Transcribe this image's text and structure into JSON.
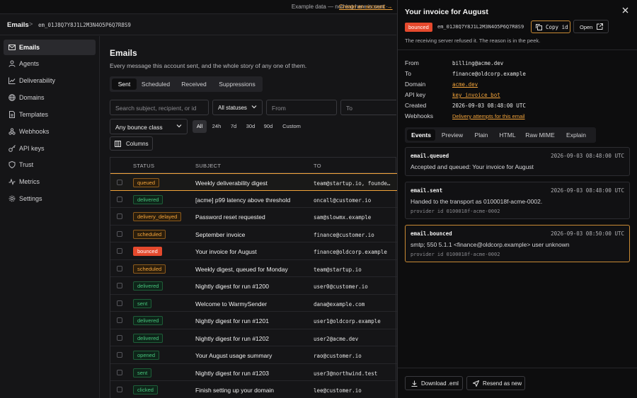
{
  "banner": {
    "text": "Example data — nothing here is sent ·",
    "link": "Create an account →"
  },
  "breadcrumb": {
    "root": "Emails",
    "sep": ">",
    "id": "em_01J8Q7Y8J1L2M3N4O5P6Q7R8S9"
  },
  "sidebar": {
    "items": [
      {
        "label": "Emails",
        "icon": "mail-icon",
        "active": true
      },
      {
        "label": "Agents",
        "icon": "agents-icon"
      },
      {
        "label": "Deliverability",
        "icon": "chart-icon"
      },
      {
        "label": "Domains",
        "icon": "globe-icon"
      },
      {
        "label": "Templates",
        "icon": "file-icon"
      },
      {
        "label": "Webhooks",
        "icon": "webhook-icon"
      },
      {
        "label": "API keys",
        "icon": "key-icon"
      },
      {
        "label": "Trust",
        "icon": "shield-icon"
      },
      {
        "label": "Metrics",
        "icon": "metrics-icon"
      },
      {
        "label": "Settings",
        "icon": "gear-icon"
      }
    ]
  },
  "main": {
    "title": "Emails",
    "subtitle": "Every message this account sent, and the whole story of any one of them.",
    "tabs": [
      "Sent",
      "Scheduled",
      "Received",
      "Suppressions"
    ],
    "search_placeholder": "Search subject, recipient, or id",
    "status_select": "All statuses",
    "from_placeholder": "From",
    "to_placeholder": "To",
    "bounce_select": "Any bounce class",
    "ranges": [
      "All",
      "24h",
      "7d",
      "30d",
      "90d",
      "Custom"
    ],
    "columns_button": "Columns"
  },
  "table": {
    "headers": [
      "STATUS",
      "SUBJECT",
      "TO"
    ],
    "rows": [
      {
        "status": "queued",
        "kind": "queued",
        "subject": "Weekly deliverability digest",
        "to": "team@startup.io, founde…"
      },
      {
        "status": "delivered",
        "kind": "delivered",
        "subject": "[acme] p99 latency above threshold",
        "to": "oncall@customer.io"
      },
      {
        "status": "delivery_delayed",
        "kind": "delayed",
        "subject": "Password reset requested",
        "to": "sam@slowmx.example"
      },
      {
        "status": "scheduled",
        "kind": "scheduled",
        "subject": "September invoice",
        "to": "finance@customer.io"
      },
      {
        "status": "bounced",
        "kind": "bounced",
        "subject": "Your invoice for August",
        "to": "finance@oldcorp.example"
      },
      {
        "status": "scheduled",
        "kind": "scheduled",
        "subject": "Weekly digest, queued for Monday",
        "to": "team@startup.io"
      },
      {
        "status": "delivered",
        "kind": "delivered",
        "subject": "Nightly digest for run #1200",
        "to": "user0@customer.io"
      },
      {
        "status": "sent",
        "kind": "sent",
        "subject": "Welcome to WarmySender",
        "to": "dana@example.com"
      },
      {
        "status": "delivered",
        "kind": "delivered",
        "subject": "Nightly digest for run #1201",
        "to": "user1@oldcorp.example"
      },
      {
        "status": "delivered",
        "kind": "delivered",
        "subject": "Nightly digest for run #1202",
        "to": "user2@acme.dev"
      },
      {
        "status": "opened",
        "kind": "opened",
        "subject": "Your August usage summary",
        "to": "rao@customer.io"
      },
      {
        "status": "sent",
        "kind": "sent",
        "subject": "Nightly digest for run #1203",
        "to": "user3@northwind.test"
      },
      {
        "status": "clicked",
        "kind": "clicked",
        "subject": "Finish setting up your domain",
        "to": "lee@customer.io"
      }
    ]
  },
  "panel": {
    "title": "Your invoice for August",
    "badge": "bounced",
    "id": "em_01J8Q7Y8J1L2M3N4O5P6Q7R8S9",
    "copy_label": "Copy id",
    "open_label": "Open",
    "reason": "The receiving server refused it. The reason is in the peek.",
    "meta": [
      {
        "label": "From",
        "value": "billing@acme.dev",
        "link": false
      },
      {
        "label": "To",
        "value": "finance@oldcorp.example",
        "link": false
      },
      {
        "label": "Domain",
        "value": "acme.dev",
        "link": true
      },
      {
        "label": "API key",
        "value": "key_invoice_bot",
        "link": true
      },
      {
        "label": "Created",
        "value": "2026-09-03 08:48:00 UTC",
        "link": false
      },
      {
        "label": "Webhooks",
        "value": "Delivery attempts for this email",
        "link": true
      }
    ],
    "tabs": [
      "Events",
      "Preview",
      "Plain",
      "HTML",
      "Raw MIME",
      "Explain"
    ],
    "events": [
      {
        "name": "email.queued",
        "time": "2026-09-03 08:48:00 UTC",
        "message": "Accepted and queued: Your invoice for August",
        "provider": ""
      },
      {
        "name": "email.sent",
        "time": "2026-09-03 08:48:00 UTC",
        "message": "Handed to the transport as 0100018f-acme-0002.",
        "provider": "provider id 0100018f-acme-0002"
      },
      {
        "name": "email.bounced",
        "time": "2026-09-03 08:50:00 UTC",
        "message": "smtp; 550 5.1.1 <finance@oldcorp.example> user unknown",
        "provider": "provider id 0100018f-acme-0002"
      }
    ],
    "download_label": "Download .eml",
    "resend_label": "Resend as new"
  },
  "colors": {
    "accent": "#f2a33a",
    "bounced": "#e5492d",
    "success": "#46c37b",
    "background": "#151517"
  }
}
